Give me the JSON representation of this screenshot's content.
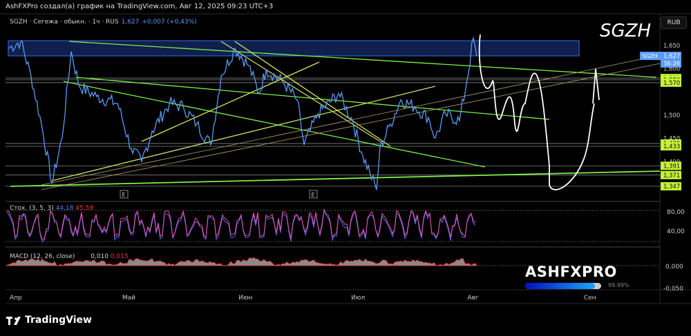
{
  "header": {
    "caption": "AshFXPro создал(а) график на TradingView.com, Авг 12, 2025 09:23 UTC+3"
  },
  "legend": {
    "title": "SGZH · Сегежа · обыкн. · 1ч · RUS",
    "last": "1,627",
    "change": "+0,007 (+0,43%)"
  },
  "symbol_watermark": "SGZH",
  "currency_button": "RUB",
  "price_tag": {
    "symbol": "SGZH",
    "price": "1,627",
    "countdown": "36:26"
  },
  "earnings_marker": "E",
  "stoch": {
    "label": "Стох. (3, 5, 3)",
    "k": "44,18",
    "d": "45,59",
    "ticks": [
      "80,00",
      "40,00"
    ]
  },
  "macd": {
    "label": "MACD (12, 26, close)",
    "v1": "0,010",
    "v2": "0,015",
    "ticks": [
      "0,000",
      "-0,050"
    ]
  },
  "brand": {
    "name": "ASHFXPRO",
    "progress_label": "99.99%",
    "progress": 99.99
  },
  "footer": {
    "logo": "TradingView"
  },
  "colors": {
    "price": "#5b9cf6",
    "level": "#c6f135",
    "tag": "#5b9cf6",
    "trend": "#7cf24a"
  },
  "chart_data": {
    "type": "line",
    "title": "SGZH · Сегежа · обыкн. · 1ч",
    "xlabel": "",
    "ylabel": "RUB",
    "x_unit": "days since Apr 1 2025",
    "time_ticks": [
      {
        "label": "Апр",
        "day": 0
      },
      {
        "label": "Май",
        "day": 30
      },
      {
        "label": "Июн",
        "day": 61
      },
      {
        "label": "Июл",
        "day": 91
      },
      {
        "label": "Авг",
        "day": 122
      },
      {
        "label": "Сен",
        "day": 153
      }
    ],
    "price_ticks": [
      {
        "label": "1,650",
        "v": 1.65
      },
      {
        "label": "1,600",
        "v": 1.6
      },
      {
        "label": "1,500",
        "v": 1.5
      },
      {
        "label": "1,450",
        "v": 1.45
      },
      {
        "label": "1,400",
        "v": 1.4
      }
    ],
    "levels": [
      {
        "label": "1,580",
        "v": 1.58
      },
      {
        "label": "1,576",
        "v": 1.576
      },
      {
        "label": "1,570",
        "v": 1.57
      },
      {
        "label": "1,439",
        "v": 1.439
      },
      {
        "label": "1,433",
        "v": 1.433
      },
      {
        "label": "1,391",
        "v": 1.391
      },
      {
        "label": "1,371",
        "v": 1.371
      },
      {
        "label": "1,347",
        "v": 1.347
      }
    ],
    "ylim": [
      1.3,
      1.72
    ],
    "series": [
      {
        "name": "SGZH",
        "points": [
          [
            -1.8,
            1.644
          ],
          [
            1.5,
            1.659
          ],
          [
            4.2,
            1.585
          ],
          [
            7,
            1.481
          ],
          [
            9.8,
            1.354
          ],
          [
            12.5,
            1.451
          ],
          [
            14.9,
            1.637
          ],
          [
            17.1,
            1.562
          ],
          [
            21.7,
            1.54
          ],
          [
            27.3,
            1.525
          ],
          [
            30.9,
            1.429
          ],
          [
            33.7,
            1.399
          ],
          [
            36.5,
            1.466
          ],
          [
            41.1,
            1.525
          ],
          [
            44.8,
            1.518
          ],
          [
            48.4,
            1.481
          ],
          [
            52.1,
            1.436
          ],
          [
            54.9,
            1.585
          ],
          [
            58.6,
            1.644
          ],
          [
            62.2,
            1.607
          ],
          [
            65,
            1.547
          ],
          [
            66.9,
            1.599
          ],
          [
            71.5,
            1.57
          ],
          [
            75.1,
            1.533
          ],
          [
            77,
            1.436
          ],
          [
            80.7,
            1.503
          ],
          [
            86.2,
            1.547
          ],
          [
            89.9,
            1.488
          ],
          [
            92.6,
            1.414
          ],
          [
            94.5,
            1.377
          ],
          [
            96.3,
            1.339
          ],
          [
            97.2,
            1.429
          ],
          [
            100,
            1.481
          ],
          [
            102.8,
            1.533
          ],
          [
            106.4,
            1.518
          ],
          [
            110.1,
            1.495
          ],
          [
            112,
            1.451
          ],
          [
            114.7,
            1.503
          ],
          [
            118.4,
            1.488
          ],
          [
            120.3,
            1.57
          ],
          [
            122.1,
            1.666
          ],
          [
            123,
            1.627
          ]
        ]
      }
    ]
  }
}
